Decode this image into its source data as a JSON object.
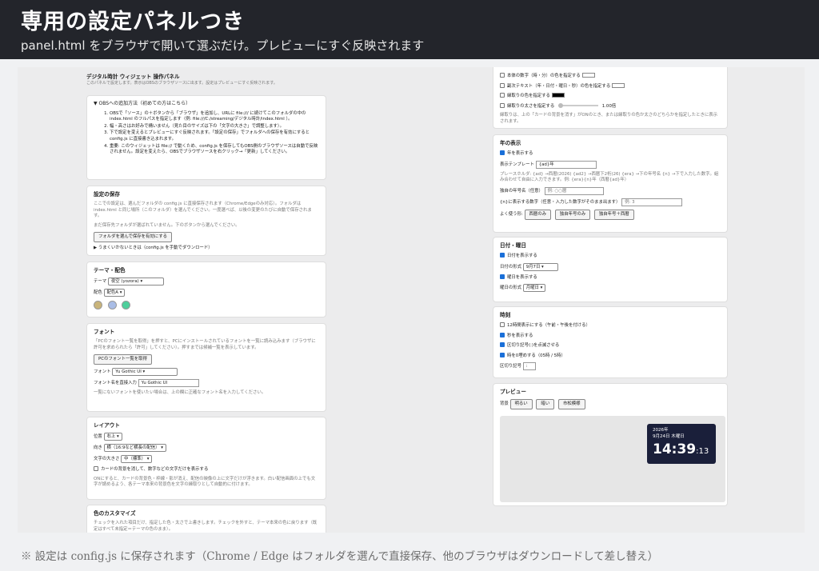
{
  "banner": {
    "title": "専用の設定パネルつき",
    "subtitle": "panel.html をブラウザで開いて選ぶだけ。プレビューにすぐ反映されます"
  },
  "panel": {
    "title": "デジタル時計 ウィジェット 操作パネル",
    "desc": "このパネルで設定します。表示はOBSのブラウザソースに出ます。設定はプレビューにすぐ反映されます。",
    "howto": {
      "summary": "▼ OBSへの追加方法（初めての方はこちら）",
      "steps": [
        "OBSで「ソース」の＋ボタンから「ブラウザ」を追加し、URLに file:/// に続けてこのフォルダの中の index.html のフルパスを指定します（例: file:///C:/streaming/デジタル時計/index.html ）。",
        "幅・高さはお好みで構いません（見た目のサイズは下の「文字の大きさ」で調整します）。",
        "下で設定を変えるとプレビューにすぐ反映されます。「設定の保存」でフォルダへの保存を有効にすると config.js に直接書き込まれます。",
        "重要: このウィジェットは file:// で動くため、config.js を保存してもOBS側のブラウザソースは自動で反映されません。設定を変えたら、OBSでブラウザソースを右クリック→「更新」してください。"
      ]
    },
    "save": {
      "title": "設定の保存",
      "desc": "ここでの設定は、選んだフォルダの config.js に直接保存されます（Chrome/Edgeのみ対応）。フォルダは index.html と同じ場所（このフォルダ）を選んでください。一度選べば、以後の変更のたびに自動で保存されます。",
      "status": "まだ保存先フォルダが選ばれていません。下のボタンから選んでください。",
      "button": "フォルダを選んで保存を有効にする",
      "fallback": "▶ うまくいかないときは（config.js を手動でダウンロード）"
    },
    "theme": {
      "title": "テーマ・配色",
      "theme_label": "テーマ",
      "theme_value": "夜空 (yozora)",
      "scheme_label": "配色",
      "scheme_value": "配色A",
      "swatch_colors": [
        "#c9b47a",
        "#a9bde6",
        "#4ecf9b"
      ]
    },
    "font": {
      "title": "フォント",
      "desc": "「PCのフォント一覧を取得」を押すと、PCにインストールされているフォントを一覧に読み込みます（ブラウザに許可を求められたら「許可」してください）。押すまでは候補一覧を表示しています。",
      "button": "PCのフォント一覧を取得",
      "font_label": "フォント",
      "font_value": "Yu Gothic UI",
      "direct_label": "フォント名を直接入力",
      "direct_value": "Yu Gothic UI",
      "note": "一覧にないフォントを使いたい場合は、上の欄に正確なフォント名を入力してください。"
    },
    "layout": {
      "title": "レイアウト",
      "pos_label": "位置",
      "pos_value": "右上",
      "dir_label": "向き",
      "dir_value": "横（16:9など横長の配信）",
      "size_label": "文字の大きさ",
      "size_value": "中（標準）",
      "bg_label": "カードの背景を消して、数字などの文字だけを表示する",
      "note": "ONにすると、カードの背景色・枠線・影が消え、配信の映像の上に文字だけが浮きます。白い配信画面の上でも文字が読めるよう、各テーマ本来の背景色を文字の縁取りとして自動的に付けます。"
    },
    "custom": {
      "title": "色のカスタマイズ",
      "desc": "チェックを入れた項目だけ、指定した色・太さで上書きします。チェックを外すと、テーマ本来の色に戻ります（既定はすべて未指定＝テーマの色のまま）。",
      "main_color": "本体の数字（時・分）の色を指定する",
      "sub_color": "副次テキスト（年・日付・曜日・秒）の色を指定する",
      "outline_color": "縁取りの色を指定する",
      "outline_width": "縁取りの太さを指定する",
      "outline_width_value": "1.00倍",
      "note": "縁取りは、上の「カードの背景を消す」がONのとき、または縁取りの色か太さのどちらかを指定したときに表示されます。"
    },
    "year": {
      "title": "年の表示",
      "show": "年を表示する",
      "template_label": "表示テンプレート",
      "template_value": "{ad}年",
      "placeholder_desc": "プレースホルダ: {ad} →西暦(2026) {ad2} →西暦下2桁(26) {era} →下の年号名 {n} →下で入力した数字。組み合わせて自由に入力できます。例: {era}{n}年（西暦{ad}年）",
      "era_label": "独自の年号名（任意）",
      "era_placeholder": "例: ○○暦",
      "n_label": "{n}に表示する数字（任意・入力した数字がそのまま出ます）",
      "n_placeholder": "例: 3",
      "quick_label": "よく使う形:",
      "quick": [
        "西暦のみ",
        "独自年号のみ",
        "独自年号＋西暦"
      ]
    },
    "date": {
      "title": "日付・曜日",
      "show": "日付を表示する",
      "format_label": "日付の形式",
      "format_value": "9月7日",
      "weekday": "曜日を表示する",
      "weekday_label": "曜日の形式",
      "weekday_value": "月曜日"
    },
    "time": {
      "title": "時刻",
      "h12": "12時間表示にする（午前・午後を付ける）",
      "seconds": "秒を表示する",
      "blink": "区切り記号(:)を点滅させる",
      "pad": "時を0埋めする（05時 / 5時）",
      "sep_label": "区切り記号",
      "sep_value": ":"
    },
    "preview": {
      "title": "プレビュー",
      "bg_label": "背景",
      "bg_buttons": [
        "明るい",
        "暗い",
        "市松模様"
      ],
      "clock_year": "2026年",
      "clock_date": "9月24日 木曜日",
      "clock_hm": "14:39",
      "clock_sec": ":13"
    }
  },
  "footer": "※ 設定は config.js に保存されます（Chrome / Edge はフォルダを選んで直接保存、他のブラウザはダウンロードして差し替え）"
}
